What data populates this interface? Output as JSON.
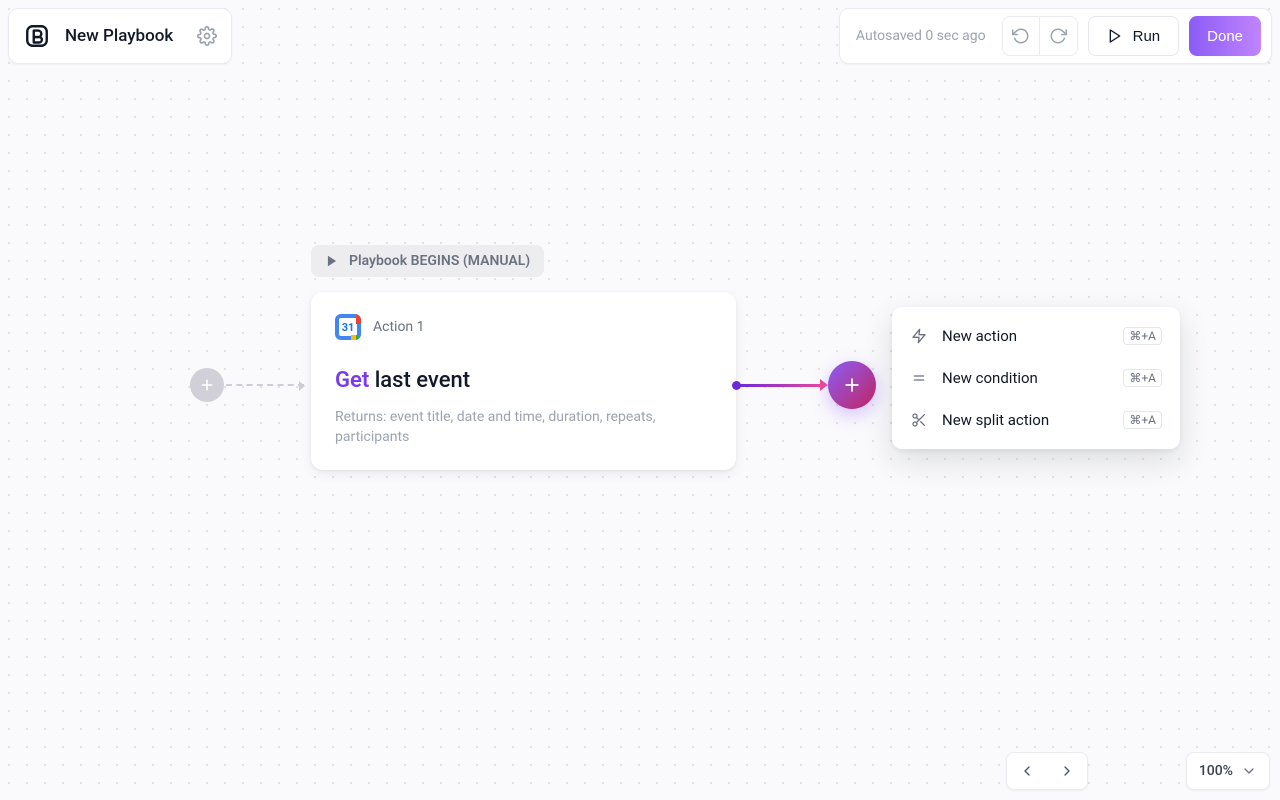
{
  "header": {
    "title": "New Playbook"
  },
  "toolbar": {
    "autosave_text": "Autosaved 0 sec ago",
    "run_label": "Run",
    "done_label": "Done"
  },
  "trigger": {
    "label": "Playbook BEGINS (MANUAL)"
  },
  "action_card": {
    "label": "Action 1",
    "title_accent": "Get",
    "title_rest": " last event",
    "description": "Returns: event title, date and time, duration, repeats, participants",
    "integration_icon": "google-calendar-icon"
  },
  "context_menu": {
    "items": [
      {
        "label": "New action",
        "shortcut": "⌘+A",
        "icon": "bolt-icon"
      },
      {
        "label": "New condition",
        "shortcut": "⌘+A",
        "icon": "equals-icon"
      },
      {
        "label": "New split action",
        "shortcut": "⌘+A",
        "icon": "scissors-icon"
      }
    ]
  },
  "zoom": {
    "level": "100%"
  }
}
